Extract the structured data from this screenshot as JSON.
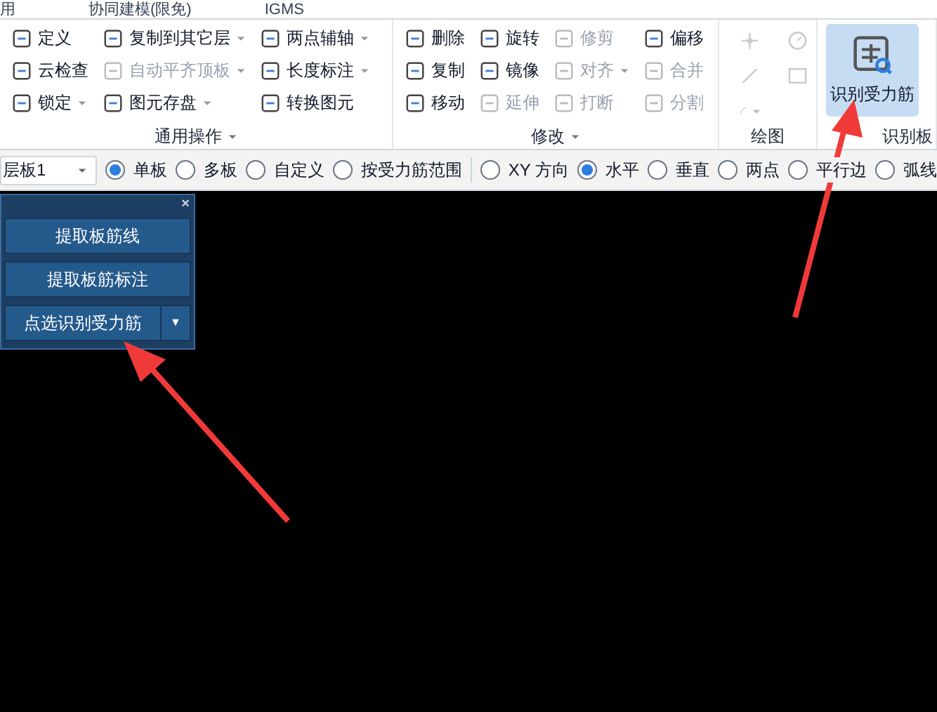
{
  "menu_bar": {
    "items": [
      "用",
      "协同建模(限免)",
      "IGMS"
    ]
  },
  "ribbon": {
    "groups": [
      {
        "label": "通用操作",
        "menu": true,
        "columns": [
          [
            {
              "label": "定义",
              "disabled": false,
              "dropdown": false
            },
            {
              "label": "云检查",
              "disabled": false,
              "dropdown": false
            },
            {
              "label": "锁定",
              "disabled": false,
              "dropdown": true
            }
          ],
          [
            {
              "label": "复制到其它层",
              "disabled": false,
              "dropdown": true
            },
            {
              "label": "自动平齐顶板",
              "disabled": true,
              "dropdown": true
            },
            {
              "label": "图元存盘",
              "disabled": false,
              "dropdown": true
            }
          ],
          [
            {
              "label": "两点辅轴",
              "disabled": false,
              "dropdown": true
            },
            {
              "label": "长度标注",
              "disabled": false,
              "dropdown": true
            },
            {
              "label": "转换图元",
              "disabled": false,
              "dropdown": false
            }
          ]
        ]
      },
      {
        "label": "修改",
        "menu": true,
        "columns": [
          [
            {
              "label": "删除",
              "disabled": false,
              "dropdown": false
            },
            {
              "label": "复制",
              "disabled": false,
              "dropdown": false
            },
            {
              "label": "移动",
              "disabled": false,
              "dropdown": false
            }
          ],
          [
            {
              "label": "旋转",
              "disabled": false,
              "dropdown": false
            },
            {
              "label": "镜像",
              "disabled": false,
              "dropdown": false
            },
            {
              "label": "延伸",
              "disabled": true,
              "dropdown": false
            }
          ],
          [
            {
              "label": "修剪",
              "disabled": true,
              "dropdown": false
            },
            {
              "label": "对齐",
              "disabled": true,
              "dropdown": true
            },
            {
              "label": "打断",
              "disabled": true,
              "dropdown": false
            }
          ],
          [
            {
              "label": "偏移",
              "disabled": false,
              "dropdown": false
            },
            {
              "label": "合并",
              "disabled": true,
              "dropdown": false
            },
            {
              "label": "分割",
              "disabled": true,
              "dropdown": false
            }
          ]
        ]
      },
      {
        "label": "绘图",
        "menu": false
      },
      {
        "label": "识别板",
        "menu": false,
        "big_button": {
          "label": "识别受力筋",
          "selected": true
        }
      }
    ]
  },
  "floor_select": {
    "value": "层板1"
  },
  "options": [
    {
      "label": "单板",
      "selected": true
    },
    {
      "label": "多板",
      "selected": false
    },
    {
      "label": "自定义",
      "selected": false
    },
    {
      "label": "按受力筋范围",
      "selected": false
    }
  ],
  "directions": [
    {
      "label": "XY 方向",
      "selected": false
    },
    {
      "label": "水平",
      "selected": true
    },
    {
      "label": "垂直",
      "selected": false
    },
    {
      "label": "两点",
      "selected": false
    },
    {
      "label": "平行边",
      "selected": false
    },
    {
      "label": "弧线",
      "selected": false
    }
  ],
  "panel": {
    "close": "×",
    "buttons": [
      {
        "label": "提取板筋线",
        "kind": "plain"
      },
      {
        "label": "提取板筋标注",
        "kind": "plain"
      },
      {
        "label": "点选识别受力筋",
        "kind": "split",
        "caret": "▼"
      }
    ]
  }
}
